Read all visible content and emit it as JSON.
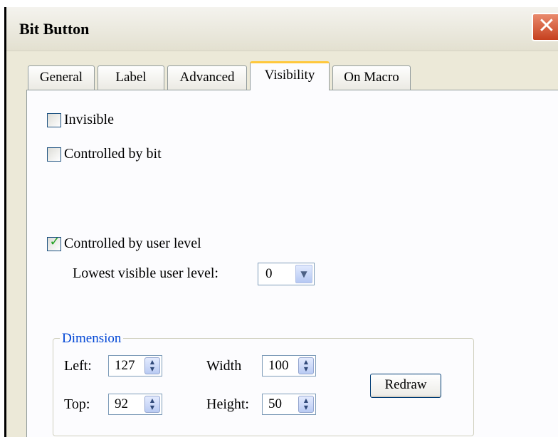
{
  "window": {
    "title": "Bit Button",
    "close_icon": "close-icon"
  },
  "tabs": [
    {
      "label": "General"
    },
    {
      "label": "Label"
    },
    {
      "label": "Advanced"
    },
    {
      "label": "Visibility",
      "active": true
    },
    {
      "label": "On Macro"
    }
  ],
  "visibility": {
    "invisible": {
      "label": "Invisible",
      "checked": false
    },
    "controlled_by_bit": {
      "label": "Controlled by bit",
      "checked": false
    },
    "controlled_by_user_level": {
      "label": "Controlled by user level",
      "checked": true
    },
    "lowest_level_label": "Lowest visible user level:",
    "lowest_level_value": "0"
  },
  "dimension": {
    "title": "Dimension",
    "left_label": "Left:",
    "left_value": "127",
    "top_label": "Top:",
    "top_value": "92",
    "width_label": "Width",
    "width_value": "100",
    "height_label": "Height:",
    "height_value": "50",
    "redraw_label": "Redraw"
  },
  "colors": {
    "accent": "#ffc83c",
    "group_title": "#0046d5",
    "close": "#c6401f"
  }
}
